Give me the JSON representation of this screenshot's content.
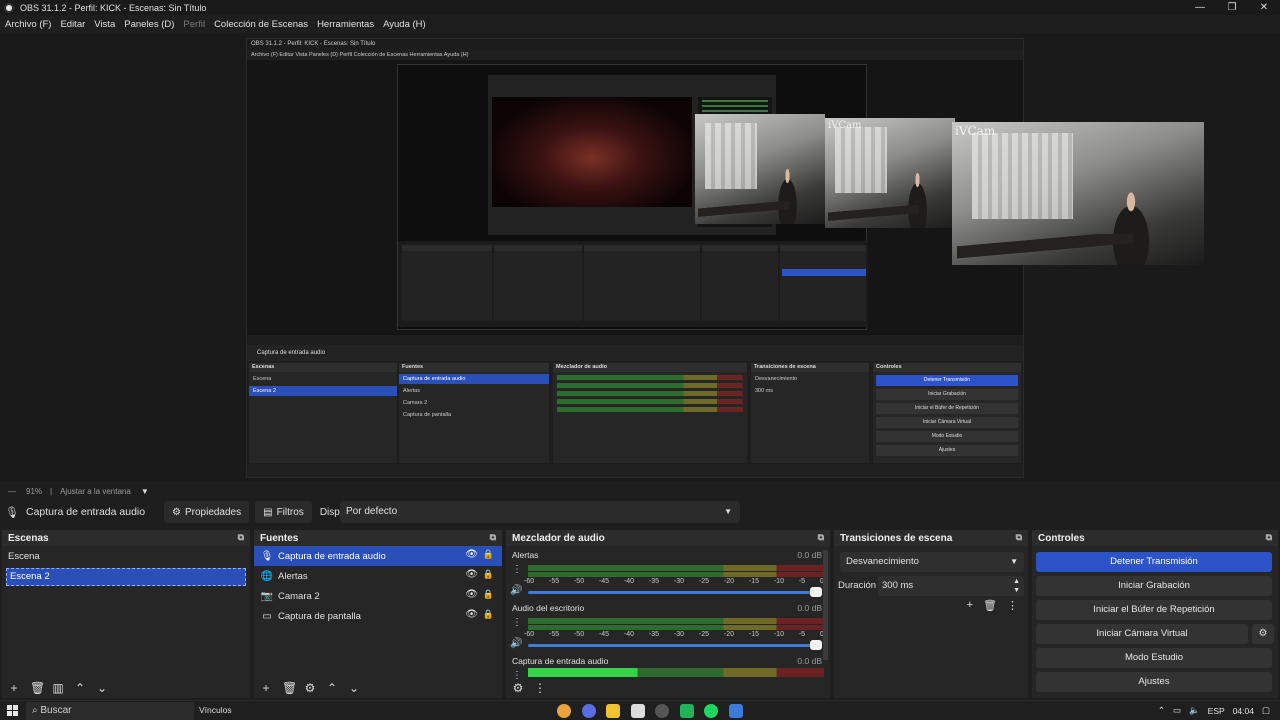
{
  "window": {
    "title": "OBS 31.1.2 - Perfil: KICK - Escenas: Sin Título",
    "controls": [
      "—",
      "❐",
      "✕"
    ]
  },
  "menu": [
    "Archivo (F)",
    "Editar",
    "Vista",
    "Paneles (D)",
    "Perfil",
    "Colección de Escenas",
    "Herramientas",
    "Ayuda (H)"
  ],
  "preview": {
    "webcam_label": "iVCam",
    "nested_title": "OBS 31.1.2 - Perfil: KICK - Escenas: Sin Título",
    "nested_menu": "Archivo (F)  Editar  Vista  Paneles (D)  Perfil  Colección de Escenas  Herramientas  Ayuda (H)"
  },
  "zoom": {
    "value": "91%",
    "fit_label": "Ajustar a la ventana"
  },
  "properties_bar": {
    "source_name": "Captura de entrada audio",
    "properties_label": "Propiedades",
    "filters_label": "Filtros",
    "device_label": "Dispositivo",
    "device_value": "Por defecto"
  },
  "scenes": {
    "title": "Escenas",
    "items": [
      "Escena",
      "Escena 2"
    ],
    "selected": "Escena 2"
  },
  "sources": {
    "title": "Fuentes",
    "items": [
      {
        "name": "Captura de entrada audio",
        "icon": "microphone-icon"
      },
      {
        "name": "Alertas",
        "icon": "globe-icon"
      },
      {
        "name": "Camara 2",
        "icon": "camera-icon"
      },
      {
        "name": "Captura de pantalla",
        "icon": "monitor-icon"
      }
    ]
  },
  "mixer": {
    "title": "Mezclador de audio",
    "channels": [
      {
        "name": "Alertas",
        "db": "0.0 dB"
      },
      {
        "name": "Audio del escritorio",
        "db": "0.0 dB"
      },
      {
        "name": "Captura de entrada audio",
        "db": "0.0 dB"
      }
    ],
    "ticks": [
      "-60",
      "-55",
      "-50",
      "-45",
      "-40",
      "-35",
      "-30",
      "-25",
      "-20",
      "-15",
      "-10",
      "-5",
      "0"
    ]
  },
  "transitions": {
    "title": "Transiciones de escena",
    "type": "Desvanecimiento",
    "duration_label": "Duración",
    "duration_value": "300 ms"
  },
  "controls": {
    "title": "Controles",
    "buttons": [
      "Detener Transmisión",
      "Iniciar Grabación",
      "Iniciar el Búfer de Repetición",
      "Iniciar Cámara Virtual",
      "Modo Estudio",
      "Ajustes"
    ]
  },
  "taskbar": {
    "search_placeholder": "Buscar",
    "links_label": "Vínculos",
    "language": "ESP",
    "time": "04:04",
    "app_colors": [
      "#e8a33c",
      "#5b6ee1",
      "#f1c232",
      "#dddddd",
      "#555555",
      "#22b35a",
      "#1ed760",
      "#3c7bd8"
    ]
  }
}
